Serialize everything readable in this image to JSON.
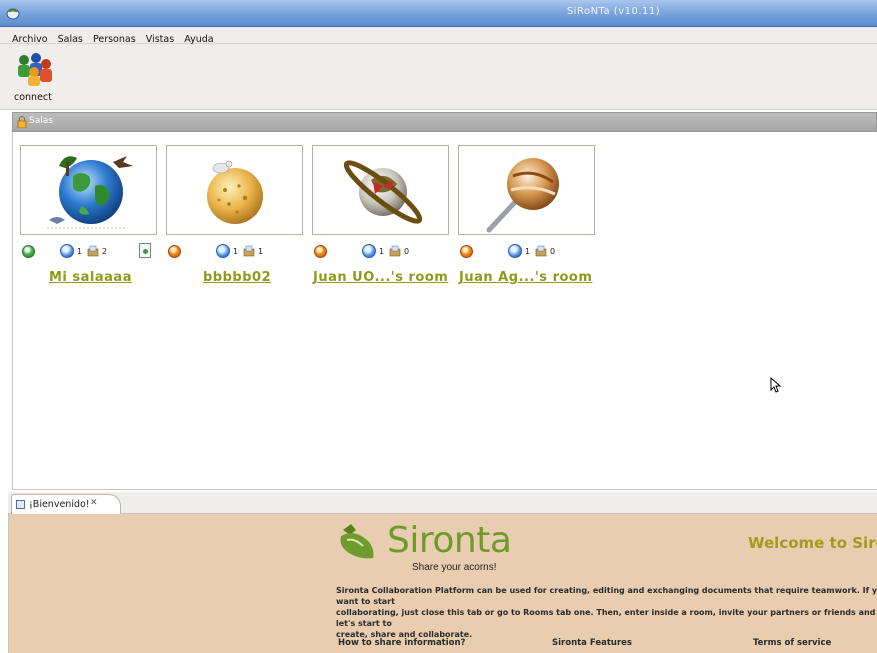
{
  "window": {
    "title": "SiRoNTa (v10.11)"
  },
  "menu": {
    "items": [
      "Archivo",
      "Salas",
      "Personas",
      "Vistas",
      "Ayuda"
    ]
  },
  "toolbar": {
    "connect_label": "connect"
  },
  "salas_view": {
    "title": "Salas",
    "rooms": [
      {
        "name": "Mi salaaaa",
        "status": "green",
        "info_count": "1",
        "files_count": "2",
        "has_doc": true,
        "image": "earth-globe"
      },
      {
        "name": "bbbbb02",
        "status": "orange",
        "info_count": "1",
        "files_count": "1",
        "has_doc": false,
        "image": "cheese-planet"
      },
      {
        "name": "Juan UO...'s room",
        "status": "orange",
        "info_count": "1",
        "files_count": "0",
        "has_doc": false,
        "image": "saturn-hat"
      },
      {
        "name": "Juan Ag...'s room",
        "status": "orange",
        "info_count": "1",
        "files_count": "0",
        "has_doc": false,
        "image": "lollipop"
      }
    ]
  },
  "editor": {
    "tab_label": "¡Bienvenido!",
    "brand_name": "Sironta",
    "tagline": "Share your acorns!",
    "welcome_heading": "Welcome to Siro",
    "description": "Sironta Collaboration Platform can be used for creating, editing and exchanging documents that require teamwork. If you want to start\ncollaborating, just close this tab or go to Rooms tab one. Then, enter inside a room, invite your partners or friends and let's start to\ncreate, share and collaborate.",
    "links": [
      "How to share information?",
      "Sironta Features",
      "Terms of service"
    ]
  },
  "colors": {
    "accent": "#8f9a1a",
    "brand_green": "#6f9a2c",
    "welcome_bg": "#e8cdb1"
  }
}
